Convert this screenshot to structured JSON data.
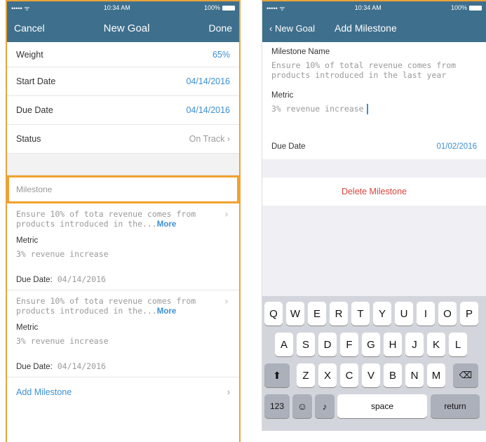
{
  "left": {
    "status": {
      "carrier": "••••• ᯤ",
      "time": "10:34 AM",
      "battery": "100%"
    },
    "nav": {
      "cancel": "Cancel",
      "title": "New Goal",
      "done": "Done"
    },
    "fields": [
      {
        "label": "Weight",
        "value": "65%"
      },
      {
        "label": "Start Date",
        "value": "04/14/2016"
      },
      {
        "label": "Due Date",
        "value": "04/14/2016"
      },
      {
        "label": "Status",
        "value": "On Track"
      }
    ],
    "milestone_label": "Milestone",
    "milestones": [
      {
        "desc": "Ensure 10% of tota revenue comes from products introduced in the...",
        "more": "More",
        "metric_label": "Metric",
        "metric": "3% revenue increase",
        "due_label": "Due Date:",
        "due": "04/14/2016"
      },
      {
        "desc": "Ensure 10% of tota revenue comes from products introduced in the...",
        "more": "More",
        "metric_label": "Metric",
        "metric": "3% revenue increase",
        "due_label": "Due Date:",
        "due": "04/14/2016"
      }
    ],
    "add_milestone": "Add Milestone"
  },
  "right": {
    "status": {
      "carrier": "••••• ᯤ",
      "time": "10:34 AM",
      "battery": "100%"
    },
    "nav": {
      "back": "New Goal",
      "title": "Add Milestone"
    },
    "name_label": "Milestone Name",
    "name_value": "Ensure 10% of total revenue comes from products introduced in the last year",
    "metric_label": "Metric",
    "metric_value": "3% revenue increase",
    "due_label": "Due Date",
    "due_value": "01/02/2016",
    "delete": "Delete Milestone",
    "keyboard": {
      "row1": [
        "Q",
        "W",
        "E",
        "R",
        "T",
        "Y",
        "U",
        "I",
        "O",
        "P"
      ],
      "row2": [
        "A",
        "S",
        "D",
        "F",
        "G",
        "H",
        "J",
        "K",
        "L"
      ],
      "row3": [
        "Z",
        "X",
        "C",
        "V",
        "B",
        "N",
        "M"
      ],
      "num": "123",
      "space": "space",
      "return": "return"
    }
  },
  "colors": {
    "header": "#3e6f8d",
    "accent": "#3b8fd3",
    "highlight": "#f0a22d",
    "delete": "#d8443c"
  }
}
